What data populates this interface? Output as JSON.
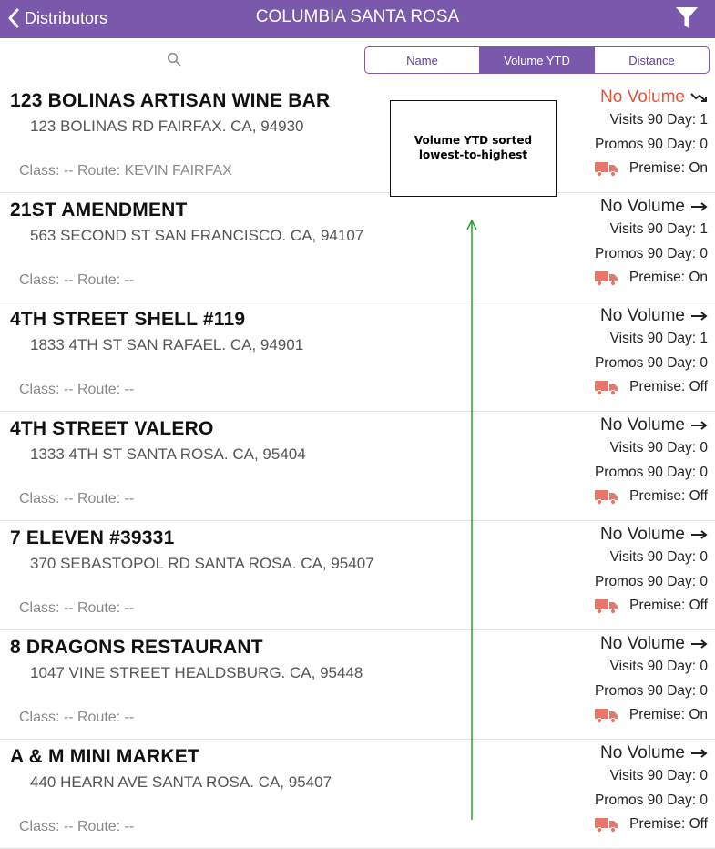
{
  "navbar": {
    "back_label": "Distributors",
    "title": "COLUMBIA SANTA ROSA",
    "filter_icon": "filter-icon"
  },
  "search": {
    "placeholder": "",
    "icon": "search-icon"
  },
  "sort_tabs": [
    {
      "label": "Name",
      "active": false
    },
    {
      "label": "Volume YTD",
      "active": true
    },
    {
      "label": "Distance",
      "active": false
    }
  ],
  "colors": {
    "header": "#7a59ad",
    "low_volume": "#e0553c",
    "truck": "#e8766a",
    "annotation_arrow": "#22a32a"
  },
  "annotation": {
    "text": "Volume YTD sorted lowest-to-highest"
  },
  "accounts": [
    {
      "name": "123 BOLINAS ARTISAN WINE BAR",
      "address": "123 BOLINAS RD FAIRFAX. CA, 94930",
      "class_route": "Class: --  Route: KEVIN FAIRFAX",
      "volume": "No Volume",
      "trend": "down",
      "visits": "Visits 90 Day: 1",
      "promos": "Promos 90 Day: 0",
      "premise": "Premise: On"
    },
    {
      "name": "21ST AMENDMENT",
      "address": "563 SECOND ST SAN FRANCISCO. CA, 94107",
      "class_route": "Class: --  Route: --",
      "volume": "No Volume",
      "trend": "flat",
      "visits": "Visits 90 Day: 1",
      "promos": "Promos 90 Day: 0",
      "premise": "Premise: On"
    },
    {
      "name": "4TH STREET SHELL #119",
      "address": "1833 4TH ST SAN RAFAEL. CA, 94901",
      "class_route": "Class: --  Route: --",
      "volume": "No Volume",
      "trend": "flat",
      "visits": "Visits 90 Day: 1",
      "promos": "Promos 90 Day: 0",
      "premise": "Premise: Off"
    },
    {
      "name": "4TH STREET VALERO",
      "address": "1333 4TH ST SANTA ROSA. CA, 95404",
      "class_route": "Class: --  Route: --",
      "volume": "No Volume",
      "trend": "flat",
      "visits": "Visits 90 Day: 0",
      "promos": "Promos 90 Day: 0",
      "premise": "Premise: Off"
    },
    {
      "name": "7 ELEVEN #39331",
      "address": "370 SEBASTOPOL RD SANTA ROSA. CA, 95407",
      "class_route": "Class: --  Route: --",
      "volume": "No Volume",
      "trend": "flat",
      "visits": "Visits 90 Day: 0",
      "promos": "Promos 90 Day: 0",
      "premise": "Premise: Off"
    },
    {
      "name": "8 DRAGONS RESTAURANT",
      "address": "1047 VINE STREET HEALDSBURG. CA, 95448",
      "class_route": "Class: --  Route: --",
      "volume": "No Volume",
      "trend": "flat",
      "visits": "Visits 90 Day: 0",
      "promos": "Promos 90 Day: 0",
      "premise": "Premise: On"
    },
    {
      "name": "A & M MINI MARKET",
      "address": "440 HEARN AVE SANTA ROSA. CA, 95407",
      "class_route": "Class: --  Route: --",
      "volume": "No Volume",
      "trend": "flat",
      "visits": "Visits 90 Day: 0",
      "promos": "Promos 90 Day: 0",
      "premise": "Premise: Off"
    }
  ]
}
